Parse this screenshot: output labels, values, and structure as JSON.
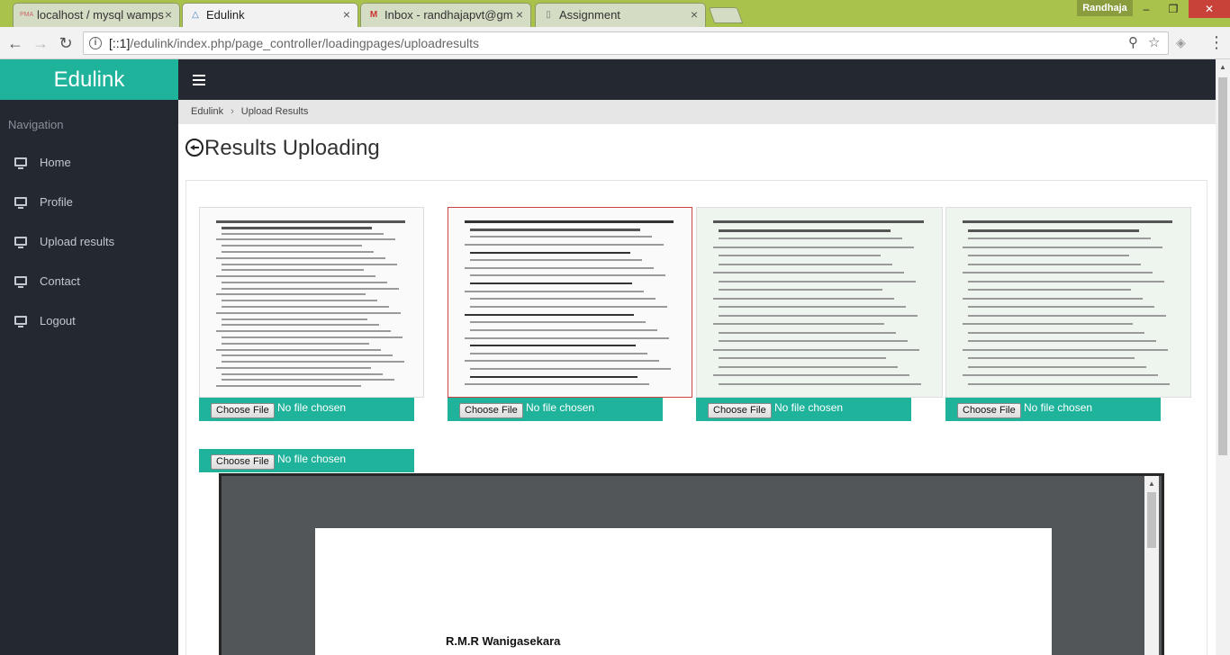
{
  "browser": {
    "tabs": [
      {
        "label": "localhost / mysql wamps",
        "favicon": "PMA"
      },
      {
        "label": "Edulink",
        "favicon": "△"
      },
      {
        "label": "Inbox - randhajapvt@gm",
        "favicon": "M"
      },
      {
        "label": "Assignment",
        "favicon": "▯"
      }
    ],
    "user": "Randhaja",
    "url_host": "[::1]",
    "url_path": "/edulink/index.php/page_controller/loadingpages/uploadresults"
  },
  "sidebar": {
    "brand": "Edulink",
    "heading": "Navigation",
    "items": [
      {
        "label": "Home"
      },
      {
        "label": "Profile"
      },
      {
        "label": "Upload results"
      },
      {
        "label": "Contact"
      },
      {
        "label": "Logout"
      }
    ]
  },
  "breadcrumb": {
    "home": "Edulink",
    "current": "Upload Results"
  },
  "page": {
    "title": "Results Uploading"
  },
  "uploads": {
    "button_label": "Choose File",
    "status": "No file chosen"
  },
  "pdf": {
    "name": "R.M.R Wanigasekara"
  }
}
